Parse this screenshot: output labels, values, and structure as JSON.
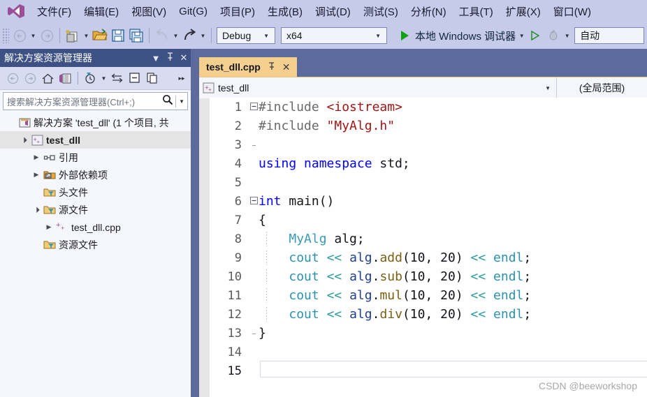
{
  "menubar": {
    "logo_icon": "visual-studio-logo",
    "items": [
      {
        "label": "文件(F)",
        "mnemonic": "F"
      },
      {
        "label": "编辑(E)",
        "mnemonic": "E"
      },
      {
        "label": "视图(V)",
        "mnemonic": "V"
      },
      {
        "label": "Git(G)",
        "mnemonic": "G"
      },
      {
        "label": "项目(P)",
        "mnemonic": "P"
      },
      {
        "label": "生成(B)",
        "mnemonic": "B"
      },
      {
        "label": "调试(D)",
        "mnemonic": "D"
      },
      {
        "label": "测试(S)",
        "mnemonic": "S"
      },
      {
        "label": "分析(N)",
        "mnemonic": "N"
      },
      {
        "label": "工具(T)",
        "mnemonic": "T"
      },
      {
        "label": "扩展(X)",
        "mnemonic": "X"
      },
      {
        "label": "窗口(W)",
        "mnemonic": "W"
      }
    ]
  },
  "toolbar": {
    "back_icon": "navigate-back-icon",
    "forward_icon": "navigate-forward-icon",
    "new_item_icon": "new-item-icon",
    "open_file_icon": "open-file-icon",
    "save_icon": "save-icon",
    "save_all_icon": "save-all-icon",
    "undo_icon": "undo-icon",
    "redo_icon": "redo-icon",
    "configuration": "Debug",
    "platform": "x64",
    "run_button_label": "本地 Windows 调试器",
    "run_icon": "play-solid-icon",
    "start_without_debug_icon": "play-hollow-icon",
    "hot_reload_icon": "hot-reload-icon",
    "auto_value": "自动"
  },
  "solution_explorer": {
    "title": "解决方案资源管理器",
    "dropdown_icon": "chevron-down-icon",
    "pin_icon": "pin-icon",
    "close_icon": "close-icon",
    "toolbar_icons": [
      "navigate-back-icon",
      "navigate-forward-icon",
      "home-icon",
      "solution-explorer-icon",
      "pending-changes-filter-icon",
      "chevron-down-icon",
      "sync-with-active-document-icon",
      "collapse-all-icon",
      "show-all-files-icon",
      "overflow-icon"
    ],
    "search_placeholder": "搜索解决方案资源管理器(Ctrl+;)",
    "search_icon": "search-icon",
    "search_dropdown_icon": "chevron-down-icon",
    "tree": [
      {
        "label": "解决方案 'test_dll' (1 个项目, 共",
        "icon": "solution-icon",
        "indent": 0,
        "twisty": "",
        "bold": false,
        "selected": false
      },
      {
        "label": "test_dll",
        "icon": "cpp-project-icon",
        "indent": 1,
        "twisty": "▲",
        "bold": true,
        "selected": true
      },
      {
        "label": "引用",
        "icon": "references-icon",
        "indent": 2,
        "twisty": "▶",
        "bold": false,
        "selected": false
      },
      {
        "label": "外部依赖项",
        "icon": "ext-deps-icon",
        "indent": 2,
        "twisty": "▶",
        "bold": false,
        "selected": false
      },
      {
        "label": "头文件",
        "icon": "filter-folder-icon",
        "indent": 2,
        "twisty": "",
        "bold": false,
        "selected": false
      },
      {
        "label": "源文件",
        "icon": "filter-folder-icon",
        "indent": 2,
        "twisty": "▲",
        "bold": false,
        "selected": false
      },
      {
        "label": "test_dll.cpp",
        "icon": "cpp-file-icon",
        "indent": 3,
        "twisty": "▶",
        "bold": false,
        "selected": false
      },
      {
        "label": "资源文件",
        "icon": "filter-folder-icon",
        "indent": 2,
        "twisty": "",
        "bold": false,
        "selected": false
      }
    ]
  },
  "editor": {
    "tab": {
      "title": "test_dll.cpp",
      "pin_icon": "pin-icon",
      "close_icon": "close-icon"
    },
    "navbar": {
      "project_icon": "cpp-project-icon",
      "project_value": "test_dll",
      "dropdown_icon": "chevron-down-icon",
      "scope_value": "(全局范围)"
    },
    "current_line": 15,
    "lines": [
      {
        "n": 1,
        "fold": "minus",
        "guide": false,
        "tokens": [
          {
            "t": "#include ",
            "c": "k-gray"
          },
          {
            "t": "<iostream>",
            "c": "k-dkred"
          }
        ]
      },
      {
        "n": 2,
        "fold": "vbar",
        "guide": false,
        "tokens": [
          {
            "t": "#include ",
            "c": "k-gray"
          },
          {
            "t": "\"MyAlg.h\"",
            "c": "k-dkred"
          }
        ]
      },
      {
        "n": 3,
        "fold": "vend",
        "guide": false,
        "tokens": []
      },
      {
        "n": 4,
        "fold": "",
        "guide": false,
        "tokens": [
          {
            "t": "using",
            "c": "k-blue"
          },
          {
            "t": " ",
            "c": "k-black"
          },
          {
            "t": "namespace",
            "c": "k-blue"
          },
          {
            "t": " std;",
            "c": "k-black"
          }
        ]
      },
      {
        "n": 5,
        "fold": "",
        "guide": false,
        "tokens": []
      },
      {
        "n": 6,
        "fold": "minus",
        "guide": false,
        "tokens": [
          {
            "t": "int",
            "c": "k-blue"
          },
          {
            "t": " main()",
            "c": "k-black"
          }
        ]
      },
      {
        "n": 7,
        "fold": "vbar",
        "guide": false,
        "tokens": [
          {
            "t": "{",
            "c": "k-black"
          }
        ]
      },
      {
        "n": 8,
        "fold": "vbar",
        "guide": true,
        "tokens": [
          {
            "t": "    ",
            "c": "k-black"
          },
          {
            "t": "MyAlg",
            "c": "k-ltteal"
          },
          {
            "t": " alg;",
            "c": "k-black"
          }
        ]
      },
      {
        "n": 9,
        "fold": "vbar",
        "guide": true,
        "tokens": [
          {
            "t": "    ",
            "c": "k-black"
          },
          {
            "t": "cout",
            "c": "k-teal"
          },
          {
            "t": " ",
            "c": "k-black"
          },
          {
            "t": "<<",
            "c": "k-op"
          },
          {
            "t": " ",
            "c": "k-black"
          },
          {
            "t": "alg",
            "c": "k-navy"
          },
          {
            "t": ".",
            "c": "k-black"
          },
          {
            "t": "add",
            "c": "k-brown"
          },
          {
            "t": "(10, 20) ",
            "c": "k-black"
          },
          {
            "t": "<<",
            "c": "k-op"
          },
          {
            "t": " ",
            "c": "k-black"
          },
          {
            "t": "endl",
            "c": "k-teal"
          },
          {
            "t": ";",
            "c": "k-black"
          }
        ]
      },
      {
        "n": 10,
        "fold": "vbar",
        "guide": true,
        "tokens": [
          {
            "t": "    ",
            "c": "k-black"
          },
          {
            "t": "cout",
            "c": "k-teal"
          },
          {
            "t": " ",
            "c": "k-black"
          },
          {
            "t": "<<",
            "c": "k-op"
          },
          {
            "t": " ",
            "c": "k-black"
          },
          {
            "t": "alg",
            "c": "k-navy"
          },
          {
            "t": ".",
            "c": "k-black"
          },
          {
            "t": "sub",
            "c": "k-brown"
          },
          {
            "t": "(10, 20) ",
            "c": "k-black"
          },
          {
            "t": "<<",
            "c": "k-op"
          },
          {
            "t": " ",
            "c": "k-black"
          },
          {
            "t": "endl",
            "c": "k-teal"
          },
          {
            "t": ";",
            "c": "k-black"
          }
        ]
      },
      {
        "n": 11,
        "fold": "vbar",
        "guide": true,
        "tokens": [
          {
            "t": "    ",
            "c": "k-black"
          },
          {
            "t": "cout",
            "c": "k-teal"
          },
          {
            "t": " ",
            "c": "k-black"
          },
          {
            "t": "<<",
            "c": "k-op"
          },
          {
            "t": " ",
            "c": "k-black"
          },
          {
            "t": "alg",
            "c": "k-navy"
          },
          {
            "t": ".",
            "c": "k-black"
          },
          {
            "t": "mul",
            "c": "k-brown"
          },
          {
            "t": "(10, 20) ",
            "c": "k-black"
          },
          {
            "t": "<<",
            "c": "k-op"
          },
          {
            "t": " ",
            "c": "k-black"
          },
          {
            "t": "endl",
            "c": "k-teal"
          },
          {
            "t": ";",
            "c": "k-black"
          }
        ]
      },
      {
        "n": 12,
        "fold": "vbar",
        "guide": true,
        "tokens": [
          {
            "t": "    ",
            "c": "k-black"
          },
          {
            "t": "cout",
            "c": "k-teal"
          },
          {
            "t": " ",
            "c": "k-black"
          },
          {
            "t": "<<",
            "c": "k-op"
          },
          {
            "t": " ",
            "c": "k-black"
          },
          {
            "t": "alg",
            "c": "k-navy"
          },
          {
            "t": ".",
            "c": "k-black"
          },
          {
            "t": "div",
            "c": "k-brown"
          },
          {
            "t": "(10, 20) ",
            "c": "k-black"
          },
          {
            "t": "<<",
            "c": "k-op"
          },
          {
            "t": " ",
            "c": "k-black"
          },
          {
            "t": "endl",
            "c": "k-teal"
          },
          {
            "t": ";",
            "c": "k-black"
          }
        ]
      },
      {
        "n": 13,
        "fold": "vend",
        "guide": false,
        "tokens": [
          {
            "t": "}",
            "c": "k-black"
          }
        ]
      },
      {
        "n": 14,
        "fold": "",
        "guide": false,
        "tokens": []
      },
      {
        "n": 15,
        "fold": "",
        "guide": false,
        "tokens": [],
        "current": true
      }
    ]
  },
  "watermark": "CSDN @beeworkshop"
}
